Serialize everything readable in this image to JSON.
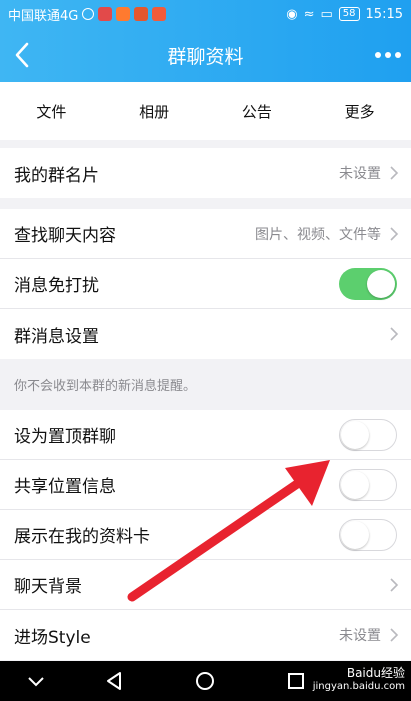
{
  "status_bar": {
    "carrier": "中国联通4G",
    "battery": "58",
    "time": "15:15"
  },
  "header": {
    "title": "群聊资料",
    "back_icon": "back-chevron-icon",
    "more_icon": "more-dots-icon"
  },
  "tabs": [
    "文件",
    "相册",
    "公告",
    "更多"
  ],
  "rows": {
    "group_card": {
      "label": "我的群名片",
      "value": "未设置"
    },
    "search_history": {
      "label": "查找聊天内容",
      "value": "图片、视频、文件等"
    },
    "do_not_disturb": {
      "label": "消息免打扰",
      "toggle": "on"
    },
    "message_settings": {
      "label": "群消息设置"
    },
    "pin_top": {
      "label": "设为置顶群聊",
      "toggle": "off"
    },
    "share_location": {
      "label": "共享位置信息",
      "toggle": "off"
    },
    "show_on_profile": {
      "label": "展示在我的资料卡",
      "toggle": "off"
    },
    "chat_background": {
      "label": "聊天背景"
    },
    "entry_style": {
      "label": "进场Style",
      "value": "未设置"
    }
  },
  "note": "你不会收到本群的新消息提醒。",
  "watermark": {
    "brand": "Baidu经验",
    "url": "jingyan.baidu.com"
  },
  "colors": {
    "header": "#1fa0f0",
    "toggle_on": "#5ccf6e",
    "annotation_arrow": "#e8232f"
  }
}
